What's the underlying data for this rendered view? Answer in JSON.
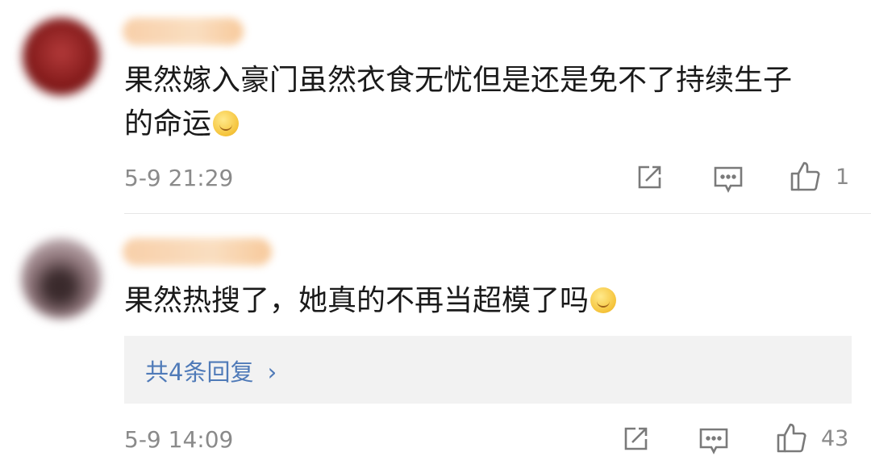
{
  "comments": [
    {
      "text_line1": "果然嫁入豪门虽然衣食无忧但是还是免不了持续生子",
      "text_line2": "的命运",
      "emoji": "smile-emoji",
      "time": "5-9 21:29",
      "likes": "1"
    },
    {
      "text_line1": "果然热搜了，她真的不再当超模了吗",
      "emoji": "laugh-cry-emoji",
      "time": "5-9 14:09",
      "replies_label": "共4条回复",
      "replies_chevron": "›",
      "likes": "43"
    }
  ],
  "icons": {
    "share": "share-icon",
    "reply": "comment-icon",
    "like": "thumbs-up-icon"
  },
  "colors": {
    "link": "#4f7ab8",
    "meta": "#8a8a8a",
    "reply_bg": "#f2f2f2"
  }
}
